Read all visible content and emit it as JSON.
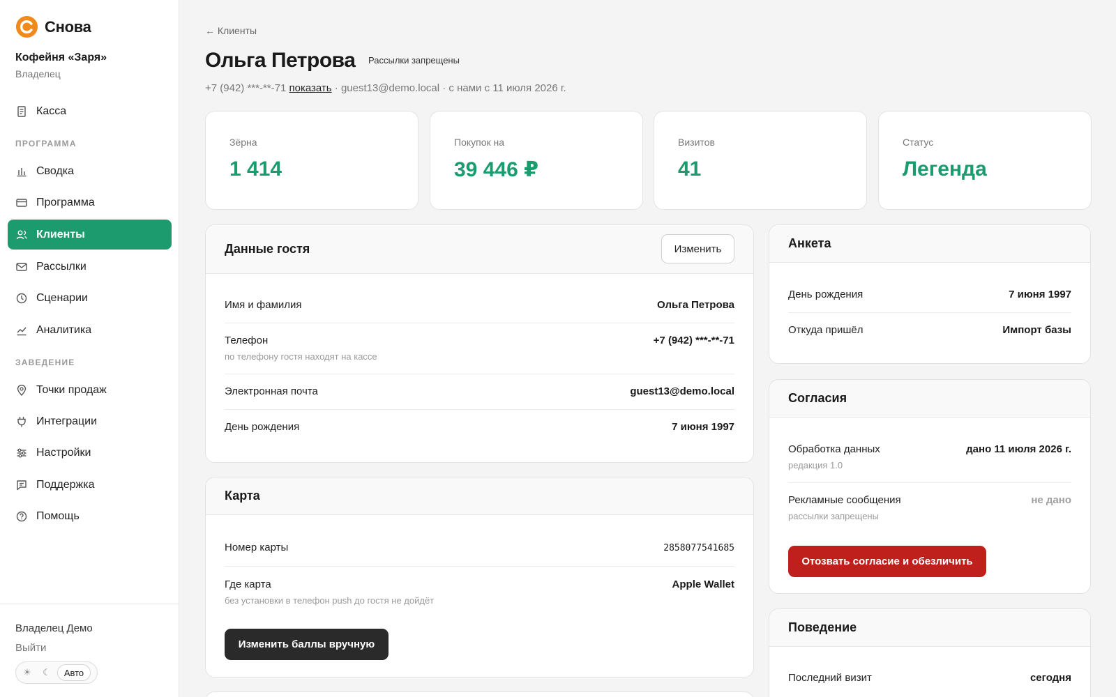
{
  "brand": {
    "name": "Снова",
    "logo_color": "#f08a1c"
  },
  "org": {
    "name": "Кофейня «Заря»",
    "role": "Владелец"
  },
  "nav": {
    "cashier": "Касса",
    "section_program": "ПРОГРАММА",
    "summary": "Сводка",
    "program": "Программа",
    "clients": "Клиенты",
    "mailings": "Рассылки",
    "scenarios": "Сценарии",
    "analytics": "Аналитика",
    "section_venue": "ЗАВЕДЕНИЕ",
    "points": "Точки продаж",
    "integrations": "Интеграции",
    "settings": "Настройки",
    "support": "Поддержка",
    "help": "Помощь"
  },
  "footer": {
    "user": "Владелец Демо",
    "logout": "Выйти",
    "theme_light": "☀",
    "theme_dark": "☾",
    "theme_auto": "Авто"
  },
  "header": {
    "back": "← Клиенты",
    "title": "Ольга Петрова",
    "badge": "Рассылки запрещены",
    "phone": "+7 (942) ***-**-71",
    "show": "показать",
    "rest": "· guest13@demo.local · с нами с 11 июля 2026 г."
  },
  "stats": [
    {
      "label": "Зёрна",
      "value": "1 414"
    },
    {
      "label": "Покупок на",
      "value": "39 446 ₽"
    },
    {
      "label": "Визитов",
      "value": "41"
    },
    {
      "label": "Статус",
      "value": "Легенда"
    }
  ],
  "guest": {
    "title": "Данные гостя",
    "edit": "Изменить",
    "name_label": "Имя и фамилия",
    "name_value": "Ольга Петрова",
    "phone_label": "Телефон",
    "phone_hint": "по телефону гостя находят на кассе",
    "phone_value": "+7 (942) ***-**-71",
    "email_label": "Электронная почта",
    "email_value": "guest13@demo.local",
    "bday_label": "День рождения",
    "bday_value": "7 июня 1997"
  },
  "card": {
    "title": "Карта",
    "number_label": "Номер карты",
    "number_value": "2858077541685",
    "where_label": "Где карта",
    "where_hint": "без установки в телефон push до гостя не дойдёт",
    "where_value": "Apple Wallet",
    "points_button": "Изменить баллы вручную"
  },
  "survey": {
    "title": "Анкета",
    "bday_label": "День рождения",
    "bday_value": "7 июня 1997",
    "source_label": "Откуда пришёл",
    "source_value": "Импорт базы"
  },
  "consents": {
    "title": "Согласия",
    "data_label": "Обработка данных",
    "data_hint": "редакция 1.0",
    "data_value": "дано 11 июля 2026 г.",
    "ads_label": "Рекламные сообщения",
    "ads_hint": "рассылки запрещены",
    "ads_value": "не дано",
    "revoke_button": "Отозвать согласие и обезличить"
  },
  "behavior": {
    "title": "Поведение",
    "last_visit_label": "Последний визит",
    "last_visit_value": "сегодня"
  },
  "colors": {
    "accent": "#1b9b6e",
    "danger": "#c0201b",
    "dark_button": "#2a2a2a"
  }
}
